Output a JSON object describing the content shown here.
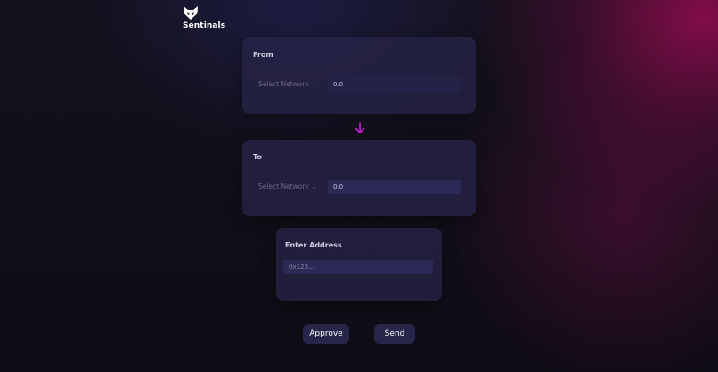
{
  "brand": {
    "name": "Sentinals",
    "logo_icon": "fox-head-icon"
  },
  "from_card": {
    "label": "From",
    "network_select": "Select Network ⌄",
    "amount_value": "0.0"
  },
  "swap_arrow": {
    "icon": "arrow-down-icon",
    "color": "#c51fd2"
  },
  "to_card": {
    "label": "To",
    "network_select": "Select Network ⌄",
    "amount_value": "0.0"
  },
  "address_card": {
    "label": "Enter Address",
    "placeholder": "0x123..."
  },
  "actions": {
    "approve_label": "Approve",
    "send_label": "Send"
  },
  "colors": {
    "accent": "#c51fd2",
    "card": "#26244a",
    "background": "#0f0d16",
    "highlight": "#960c50"
  }
}
